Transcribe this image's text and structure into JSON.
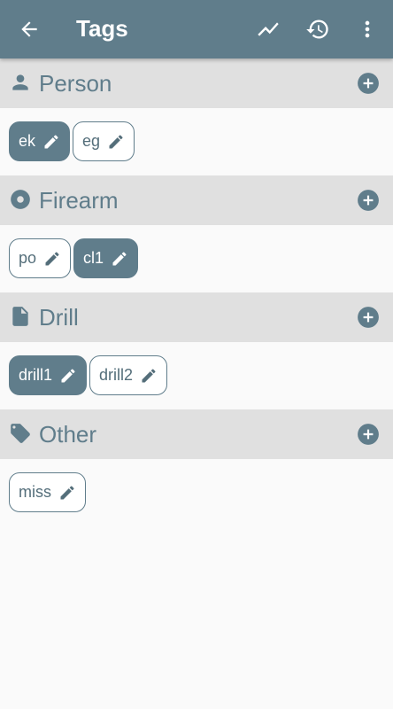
{
  "appbar": {
    "title": "Tags",
    "icons": [
      "back-arrow-icon",
      "trending-chart-icon",
      "history-icon",
      "more-vert-icon"
    ]
  },
  "colors": {
    "primary": "#607d8b",
    "header_bg": "#e0e0e0",
    "background": "#fafafa"
  },
  "sections": [
    {
      "title": "Person",
      "icon": "person-icon",
      "tags": [
        {
          "label": "ek",
          "selected": true
        },
        {
          "label": "eg",
          "selected": false
        }
      ]
    },
    {
      "title": "Firearm",
      "icon": "target-icon",
      "tags": [
        {
          "label": "po",
          "selected": false
        },
        {
          "label": "cl1",
          "selected": true
        }
      ]
    },
    {
      "title": "Drill",
      "icon": "document-icon",
      "tags": [
        {
          "label": "drill1",
          "selected": true
        },
        {
          "label": "drill2",
          "selected": false
        }
      ]
    },
    {
      "title": "Other",
      "icon": "label-tag-icon",
      "tags": [
        {
          "label": "miss",
          "selected": false
        }
      ]
    }
  ]
}
